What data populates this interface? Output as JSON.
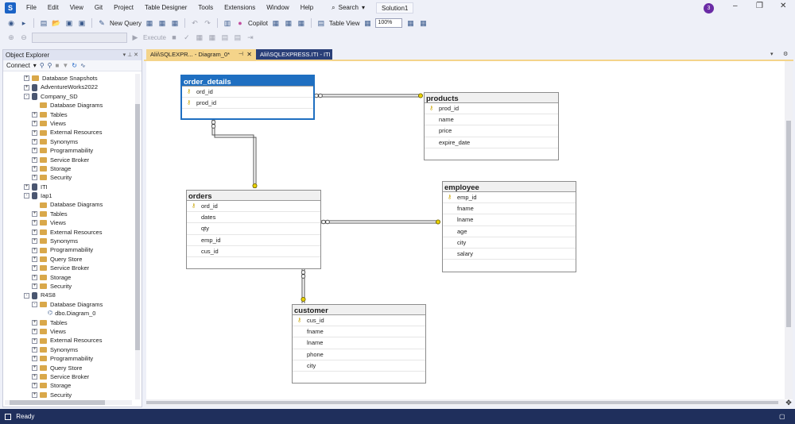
{
  "menubar": {
    "items": [
      "File",
      "Edit",
      "View",
      "Git",
      "Project",
      "Table Designer",
      "Tools",
      "Extensions",
      "Window",
      "Help"
    ],
    "search_label": "Search",
    "solution": "Solution1",
    "avatar_initial": "3"
  },
  "toolbar": {
    "new_query": "New Query",
    "copilot": "Copilot",
    "table_view": "Table View",
    "zoom": "100%",
    "execute": "Execute"
  },
  "object_explorer": {
    "title": "Object Explorer",
    "connect": "Connect",
    "tree": [
      {
        "label": "Database Snapshots",
        "icon": "folder",
        "indent": 1,
        "expander": "+"
      },
      {
        "label": "AdventureWorks2022",
        "icon": "database",
        "indent": 1,
        "expander": "+"
      },
      {
        "label": "Company_SD",
        "icon": "database",
        "indent": 1,
        "expander": "-"
      },
      {
        "label": "Database Diagrams",
        "icon": "folder",
        "indent": 2,
        "expander": ""
      },
      {
        "label": "Tables",
        "icon": "folder",
        "indent": 2,
        "expander": "+"
      },
      {
        "label": "Views",
        "icon": "folder",
        "indent": 2,
        "expander": "+"
      },
      {
        "label": "External Resources",
        "icon": "folder",
        "indent": 2,
        "expander": "+"
      },
      {
        "label": "Synonyms",
        "icon": "folder",
        "indent": 2,
        "expander": "+"
      },
      {
        "label": "Programmability",
        "icon": "folder",
        "indent": 2,
        "expander": "+"
      },
      {
        "label": "Service Broker",
        "icon": "folder",
        "indent": 2,
        "expander": "+"
      },
      {
        "label": "Storage",
        "icon": "folder",
        "indent": 2,
        "expander": "+"
      },
      {
        "label": "Security",
        "icon": "folder",
        "indent": 2,
        "expander": "+"
      },
      {
        "label": "ITI",
        "icon": "database",
        "indent": 1,
        "expander": "+"
      },
      {
        "label": "Iap1",
        "icon": "database",
        "indent": 1,
        "expander": "-"
      },
      {
        "label": "Database Diagrams",
        "icon": "folder",
        "indent": 2,
        "expander": ""
      },
      {
        "label": "Tables",
        "icon": "folder",
        "indent": 2,
        "expander": "+"
      },
      {
        "label": "Views",
        "icon": "folder",
        "indent": 2,
        "expander": "+"
      },
      {
        "label": "External Resources",
        "icon": "folder",
        "indent": 2,
        "expander": "+"
      },
      {
        "label": "Synonyms",
        "icon": "folder",
        "indent": 2,
        "expander": "+"
      },
      {
        "label": "Programmability",
        "icon": "folder",
        "indent": 2,
        "expander": "+"
      },
      {
        "label": "Query Store",
        "icon": "folder",
        "indent": 2,
        "expander": "+"
      },
      {
        "label": "Service Broker",
        "icon": "folder",
        "indent": 2,
        "expander": "+"
      },
      {
        "label": "Storage",
        "icon": "folder",
        "indent": 2,
        "expander": "+"
      },
      {
        "label": "Security",
        "icon": "folder",
        "indent": 2,
        "expander": "+"
      },
      {
        "label": "R4S8",
        "icon": "database",
        "indent": 1,
        "expander": "-"
      },
      {
        "label": "Database Diagrams",
        "icon": "folder",
        "indent": 2,
        "expander": "-"
      },
      {
        "label": "dbo.Diagram_0",
        "icon": "diagram",
        "indent": 3,
        "expander": ""
      },
      {
        "label": "Tables",
        "icon": "folder",
        "indent": 2,
        "expander": "+"
      },
      {
        "label": "Views",
        "icon": "folder",
        "indent": 2,
        "expander": "+"
      },
      {
        "label": "External Resources",
        "icon": "folder",
        "indent": 2,
        "expander": "+"
      },
      {
        "label": "Synonyms",
        "icon": "folder",
        "indent": 2,
        "expander": "+"
      },
      {
        "label": "Programmability",
        "icon": "folder",
        "indent": 2,
        "expander": "+"
      },
      {
        "label": "Query Store",
        "icon": "folder",
        "indent": 2,
        "expander": "+"
      },
      {
        "label": "Service Broker",
        "icon": "folder",
        "indent": 2,
        "expander": "+"
      },
      {
        "label": "Storage",
        "icon": "folder",
        "indent": 2,
        "expander": "+"
      },
      {
        "label": "Security",
        "icon": "folder",
        "indent": 2,
        "expander": "+"
      }
    ]
  },
  "tabs": {
    "active": "Alii\\SQLEXPR... - Diagram_0*",
    "inactive": "Alii\\SQLEXPRESS.ITI - ITI"
  },
  "diagram": {
    "order_details": {
      "title": "order_details",
      "columns": [
        {
          "name": "ord_id",
          "key": true
        },
        {
          "name": "prod_id",
          "key": true
        }
      ]
    },
    "products": {
      "title": "products",
      "columns": [
        {
          "name": "prod_id",
          "key": true
        },
        {
          "name": "name",
          "key": false
        },
        {
          "name": "price",
          "key": false
        },
        {
          "name": "expire_date",
          "key": false
        }
      ]
    },
    "orders": {
      "title": "orders",
      "columns": [
        {
          "name": "ord_id",
          "key": true
        },
        {
          "name": "dates",
          "key": false
        },
        {
          "name": "qty",
          "key": false
        },
        {
          "name": "emp_id",
          "key": false
        },
        {
          "name": "cus_id",
          "key": false
        }
      ]
    },
    "employee": {
      "title": "employee",
      "columns": [
        {
          "name": "emp_id",
          "key": true
        },
        {
          "name": "fname",
          "key": false
        },
        {
          "name": "lname",
          "key": false
        },
        {
          "name": "age",
          "key": false
        },
        {
          "name": "city",
          "key": false
        },
        {
          "name": "salary",
          "key": false
        }
      ]
    },
    "customer": {
      "title": "customer",
      "columns": [
        {
          "name": "cus_id",
          "key": true
        },
        {
          "name": "fname",
          "key": false
        },
        {
          "name": "lname",
          "key": false
        },
        {
          "name": "phone",
          "key": false
        },
        {
          "name": "city",
          "key": false
        }
      ]
    }
  },
  "status": {
    "text": "Ready"
  },
  "colors": {
    "accent": "#1f6fc1",
    "active_tab": "#f4d48a",
    "statusbar": "#1f2f5c",
    "key": "#c9a400"
  }
}
